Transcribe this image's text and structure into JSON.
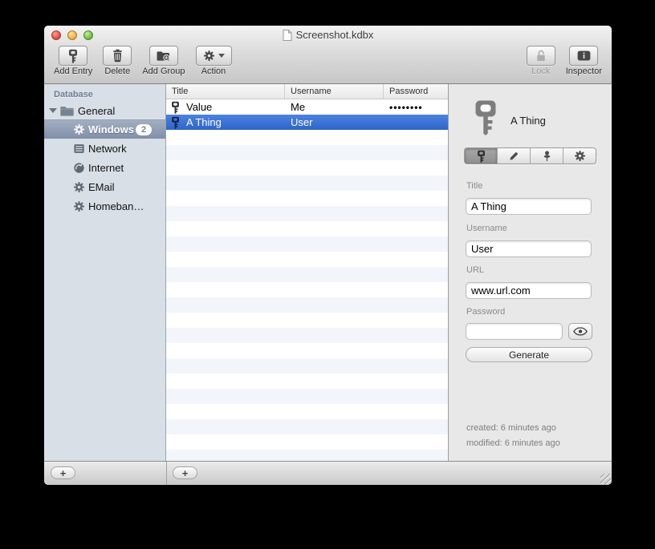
{
  "window": {
    "title": "Screenshot.kdbx",
    "doc_icon": "document-icon"
  },
  "toolbar": {
    "items": [
      {
        "label": "Add Entry",
        "icon": "key-icon"
      },
      {
        "label": "Delete",
        "icon": "trash-icon"
      },
      {
        "label": "Add Group",
        "icon": "folder-plus-icon"
      },
      {
        "label": "Action",
        "icon": "gear-icon",
        "has_dropdown": true
      }
    ],
    "right_items": [
      {
        "label": "Lock",
        "icon": "padlock-open-icon",
        "disabled": true
      },
      {
        "label": "Inspector",
        "icon": "info-icon",
        "disabled": false
      }
    ]
  },
  "sidebar": {
    "header": "Database",
    "group": {
      "label": "General",
      "icon": "folder-icon",
      "expanded": true
    },
    "items": [
      {
        "label": "Windows",
        "icon": "gear-icon",
        "badge": "2",
        "selected": true
      },
      {
        "label": "Network",
        "icon": "server-icon",
        "badge": "",
        "selected": false
      },
      {
        "label": "Internet",
        "icon": "globe-icon",
        "badge": "",
        "selected": false
      },
      {
        "label": "EMail",
        "icon": "gear-icon",
        "badge": "",
        "selected": false
      },
      {
        "label": "Homeban…",
        "icon": "gear-icon",
        "badge": "",
        "selected": false
      }
    ],
    "add_button_label": "+"
  },
  "table": {
    "columns": [
      "Title",
      "Username",
      "Password"
    ],
    "rows": [
      {
        "icon": "key-icon",
        "title": "Value",
        "username": "Me",
        "password": "••••••••",
        "selected": false
      },
      {
        "icon": "key-icon",
        "title": "A Thing",
        "username": "User",
        "password": "",
        "selected": true
      }
    ],
    "add_button_label": "+"
  },
  "inspector": {
    "entry_icon": "key-icon",
    "entry_title": "A Thing",
    "tabs": [
      "key-icon",
      "pencil-icon",
      "pin-icon",
      "gear-icon"
    ],
    "active_tab": 0,
    "fields": [
      {
        "label": "Title",
        "value": "A Thing"
      },
      {
        "label": "Username",
        "value": "User"
      },
      {
        "label": "URL",
        "value": "www.url.com"
      },
      {
        "label": "Password",
        "value": ""
      }
    ],
    "password_reveal_icon": "eye-icon",
    "generate_label": "Generate",
    "created": "created: 6 minutes ago",
    "modified": "modified: 6 minutes ago"
  },
  "colors": {
    "selection_blue": "#3a74d8",
    "sidebar_selection": "#8A99B3",
    "sidebar_bg": "#d8dfe6",
    "panel_bg": "#e8e8e8"
  }
}
